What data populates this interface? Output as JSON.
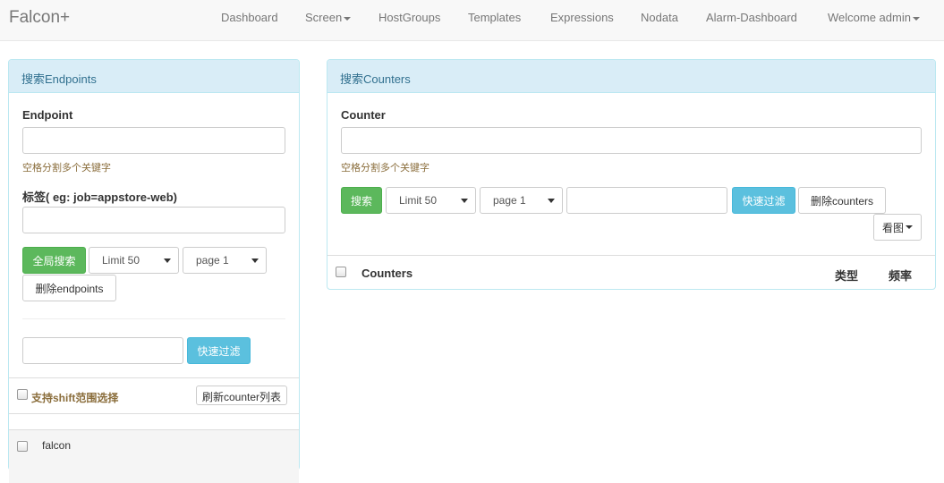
{
  "navbar": {
    "brand": "Falcon+",
    "items": [
      "Dashboard",
      "Screen",
      "HostGroups",
      "Templates",
      "Expressions",
      "Nodata",
      "Alarm-Dashboard",
      "Welcome admin"
    ]
  },
  "endpoints_panel": {
    "title": "搜索Endpoints",
    "endpoint_label": "Endpoint",
    "endpoint_value": "",
    "endpoint_help": "空格分割多个关键字",
    "tag_label": "标签( eg: job=appstore-web)",
    "tag_value": "",
    "global_search_button": "全局搜索",
    "limit_select": "Limit 50",
    "page_select": "page 1",
    "delete_button": "删除endpoints",
    "filter_value": "",
    "quick_filter_button": "快速过滤",
    "shift_select_label": "支持shift范围选择",
    "refresh_button": "刷新counter列表",
    "rows": [
      "falcon"
    ]
  },
  "counters_panel": {
    "title": "搜索Counters",
    "counter_label": "Counter",
    "counter_value": "",
    "counter_help": "空格分割多个关键字",
    "search_button": "搜索",
    "limit_select": "Limit 50",
    "page_select": "page 1",
    "filter_value": "",
    "quick_filter_button": "快速过滤",
    "delete_button": "删除counters",
    "view_graph_button": "看图",
    "table_headers": [
      "Counters",
      "类型",
      "频率"
    ]
  },
  "colors": {
    "panel_heading_bg": "#d9edf7",
    "panel_heading_text": "#31708f",
    "success": "#5cb85c",
    "info": "#5bc0de",
    "help_text": "#8a6d3b"
  }
}
